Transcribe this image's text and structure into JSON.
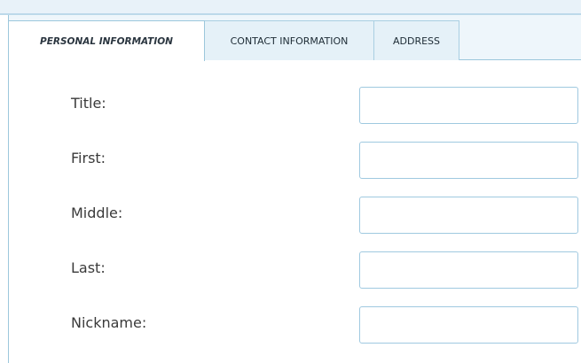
{
  "tabs": [
    {
      "label": "PERSONAL INFORMATION",
      "active": true
    },
    {
      "label": "CONTACT INFORMATION",
      "active": false
    },
    {
      "label": "ADDRESS",
      "active": false
    }
  ],
  "form": {
    "fields": [
      {
        "label": "Title:",
        "value": "",
        "placeholder": ""
      },
      {
        "label": "First:",
        "value": "",
        "placeholder": ""
      },
      {
        "label": "Middle:",
        "value": "",
        "placeholder": ""
      },
      {
        "label": "Last:",
        "value": "",
        "placeholder": ""
      },
      {
        "label": "Nickname:",
        "value": "",
        "placeholder": ""
      }
    ]
  },
  "colors": {
    "tab_border": "#9cc7dc",
    "tab_background": "#e5f1f8",
    "field_border": "#9fc9e0"
  }
}
